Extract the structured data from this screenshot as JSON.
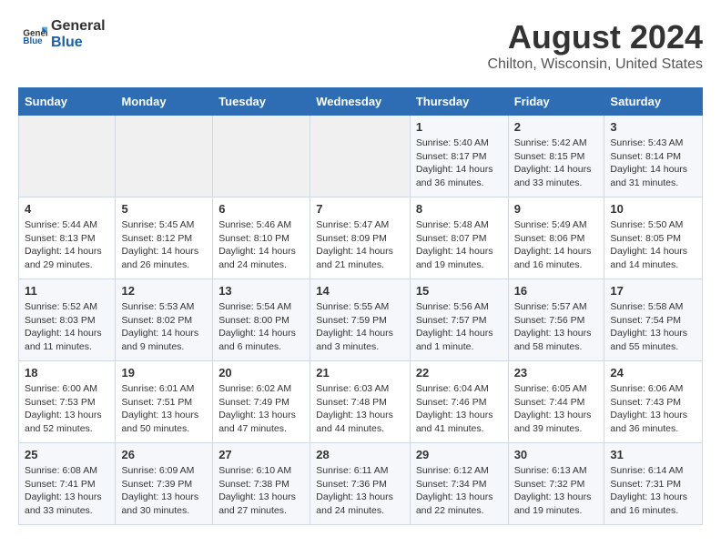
{
  "header": {
    "logo_general": "General",
    "logo_blue": "Blue",
    "month_year": "August 2024",
    "location": "Chilton, Wisconsin, United States"
  },
  "weekdays": [
    "Sunday",
    "Monday",
    "Tuesday",
    "Wednesday",
    "Thursday",
    "Friday",
    "Saturday"
  ],
  "weeks": [
    [
      {
        "day": "",
        "content": ""
      },
      {
        "day": "",
        "content": ""
      },
      {
        "day": "",
        "content": ""
      },
      {
        "day": "",
        "content": ""
      },
      {
        "day": "1",
        "content": "Sunrise: 5:40 AM\nSunset: 8:17 PM\nDaylight: 14 hours\nand 36 minutes."
      },
      {
        "day": "2",
        "content": "Sunrise: 5:42 AM\nSunset: 8:15 PM\nDaylight: 14 hours\nand 33 minutes."
      },
      {
        "day": "3",
        "content": "Sunrise: 5:43 AM\nSunset: 8:14 PM\nDaylight: 14 hours\nand 31 minutes."
      }
    ],
    [
      {
        "day": "4",
        "content": "Sunrise: 5:44 AM\nSunset: 8:13 PM\nDaylight: 14 hours\nand 29 minutes."
      },
      {
        "day": "5",
        "content": "Sunrise: 5:45 AM\nSunset: 8:12 PM\nDaylight: 14 hours\nand 26 minutes."
      },
      {
        "day": "6",
        "content": "Sunrise: 5:46 AM\nSunset: 8:10 PM\nDaylight: 14 hours\nand 24 minutes."
      },
      {
        "day": "7",
        "content": "Sunrise: 5:47 AM\nSunset: 8:09 PM\nDaylight: 14 hours\nand 21 minutes."
      },
      {
        "day": "8",
        "content": "Sunrise: 5:48 AM\nSunset: 8:07 PM\nDaylight: 14 hours\nand 19 minutes."
      },
      {
        "day": "9",
        "content": "Sunrise: 5:49 AM\nSunset: 8:06 PM\nDaylight: 14 hours\nand 16 minutes."
      },
      {
        "day": "10",
        "content": "Sunrise: 5:50 AM\nSunset: 8:05 PM\nDaylight: 14 hours\nand 14 minutes."
      }
    ],
    [
      {
        "day": "11",
        "content": "Sunrise: 5:52 AM\nSunset: 8:03 PM\nDaylight: 14 hours\nand 11 minutes."
      },
      {
        "day": "12",
        "content": "Sunrise: 5:53 AM\nSunset: 8:02 PM\nDaylight: 14 hours\nand 9 minutes."
      },
      {
        "day": "13",
        "content": "Sunrise: 5:54 AM\nSunset: 8:00 PM\nDaylight: 14 hours\nand 6 minutes."
      },
      {
        "day": "14",
        "content": "Sunrise: 5:55 AM\nSunset: 7:59 PM\nDaylight: 14 hours\nand 3 minutes."
      },
      {
        "day": "15",
        "content": "Sunrise: 5:56 AM\nSunset: 7:57 PM\nDaylight: 14 hours\nand 1 minute."
      },
      {
        "day": "16",
        "content": "Sunrise: 5:57 AM\nSunset: 7:56 PM\nDaylight: 13 hours\nand 58 minutes."
      },
      {
        "day": "17",
        "content": "Sunrise: 5:58 AM\nSunset: 7:54 PM\nDaylight: 13 hours\nand 55 minutes."
      }
    ],
    [
      {
        "day": "18",
        "content": "Sunrise: 6:00 AM\nSunset: 7:53 PM\nDaylight: 13 hours\nand 52 minutes."
      },
      {
        "day": "19",
        "content": "Sunrise: 6:01 AM\nSunset: 7:51 PM\nDaylight: 13 hours\nand 50 minutes."
      },
      {
        "day": "20",
        "content": "Sunrise: 6:02 AM\nSunset: 7:49 PM\nDaylight: 13 hours\nand 47 minutes."
      },
      {
        "day": "21",
        "content": "Sunrise: 6:03 AM\nSunset: 7:48 PM\nDaylight: 13 hours\nand 44 minutes."
      },
      {
        "day": "22",
        "content": "Sunrise: 6:04 AM\nSunset: 7:46 PM\nDaylight: 13 hours\nand 41 minutes."
      },
      {
        "day": "23",
        "content": "Sunrise: 6:05 AM\nSunset: 7:44 PM\nDaylight: 13 hours\nand 39 minutes."
      },
      {
        "day": "24",
        "content": "Sunrise: 6:06 AM\nSunset: 7:43 PM\nDaylight: 13 hours\nand 36 minutes."
      }
    ],
    [
      {
        "day": "25",
        "content": "Sunrise: 6:08 AM\nSunset: 7:41 PM\nDaylight: 13 hours\nand 33 minutes."
      },
      {
        "day": "26",
        "content": "Sunrise: 6:09 AM\nSunset: 7:39 PM\nDaylight: 13 hours\nand 30 minutes."
      },
      {
        "day": "27",
        "content": "Sunrise: 6:10 AM\nSunset: 7:38 PM\nDaylight: 13 hours\nand 27 minutes."
      },
      {
        "day": "28",
        "content": "Sunrise: 6:11 AM\nSunset: 7:36 PM\nDaylight: 13 hours\nand 24 minutes."
      },
      {
        "day": "29",
        "content": "Sunrise: 6:12 AM\nSunset: 7:34 PM\nDaylight: 13 hours\nand 22 minutes."
      },
      {
        "day": "30",
        "content": "Sunrise: 6:13 AM\nSunset: 7:32 PM\nDaylight: 13 hours\nand 19 minutes."
      },
      {
        "day": "31",
        "content": "Sunrise: 6:14 AM\nSunset: 7:31 PM\nDaylight: 13 hours\nand 16 minutes."
      }
    ]
  ]
}
